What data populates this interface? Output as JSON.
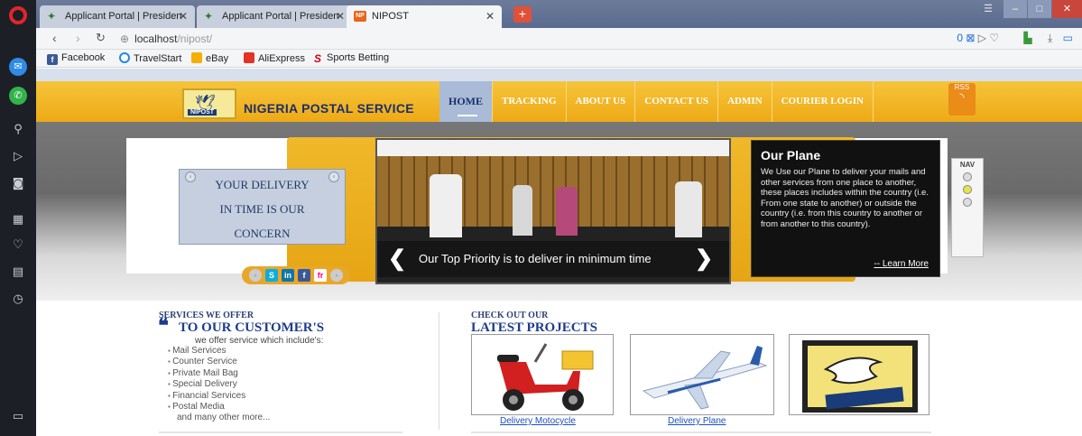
{
  "browser": {
    "tabs": [
      {
        "title": "Applicant Portal | Presiden",
        "active": false
      },
      {
        "title": "Applicant Portal | Presiden",
        "active": false
      },
      {
        "title": "NIPOST",
        "active": true
      }
    ],
    "favicon_np": "NP",
    "new_tab": "+",
    "url_host": "localhost",
    "url_path": "/nipost/",
    "window_controls": [
      "–",
      "□",
      "✕"
    ],
    "bookmarks": [
      {
        "label": "Facebook",
        "icon": "facebook-icon",
        "color": "#3b5998",
        "glyph": "f"
      },
      {
        "label": "TravelStart",
        "icon": "travelstart-icon",
        "color": "#1e88e5",
        "glyph": "O"
      },
      {
        "label": "eBay",
        "icon": "ebay-icon",
        "color": "#f5af02",
        "glyph": "e"
      },
      {
        "label": "AliExpress",
        "icon": "aliexpress-icon",
        "color": "#e43225",
        "glyph": "A"
      },
      {
        "label": "Sports Betting",
        "icon": "sportsbetting-icon",
        "color": "#d0021b",
        "glyph": "S"
      }
    ]
  },
  "site": {
    "name": "NIGERIA POSTAL SERVICE",
    "logo_tag": "NIPOST",
    "menu": [
      "HOME",
      "TRACKING",
      "ABOUT US",
      "CONTACT US",
      "ADMIN",
      "COURIER LOGIN"
    ],
    "rss_label": "RSS"
  },
  "banner": {
    "note_lines": [
      "YOUR DELIVERY",
      "IN TIME IS OUR",
      "CONCERN"
    ],
    "caption": "Our Top Priority is to deliver in minimum time",
    "social": [
      {
        "icon": "skype-icon",
        "glyph": "S",
        "color": "#0aaee0"
      },
      {
        "icon": "linkedin-icon",
        "glyph": "in",
        "color": "#0e76a8"
      },
      {
        "icon": "facebook-icon",
        "glyph": "f",
        "color": "#3b5998"
      },
      {
        "icon": "flickr-icon",
        "glyph": "fr",
        "color": "#ff0084"
      }
    ],
    "panel": {
      "title": "Our Plane",
      "body": "We Use our Plane to deliver your mails and other services from one place to another, these places includes within the country (i.e. From one state to another) or outside the country (i.e. from this country to another or from another to this country).",
      "link": "-- Learn More"
    },
    "nav_widget": "NAV"
  },
  "services": {
    "subtitle": "SERVICES WE OFFER",
    "title": "TO OUR CUSTOMER'S",
    "intro": "we offer service which include's:",
    "items": [
      "Mail Services",
      "Counter Service",
      "Private Mail Bag",
      "Special Delivery",
      "Financial Services",
      "Postal Media"
    ],
    "tail": "and many other more..."
  },
  "projects": {
    "subtitle": "CHECK OUT OUR",
    "title": "LATEST PROJECTS",
    "items": [
      {
        "caption": "Delivery Motocycle"
      },
      {
        "caption": "Delivery Plane"
      },
      {
        "caption": ""
      }
    ]
  },
  "colors": {
    "header": "#f0b42a",
    "brand_blue": "#1d3d8c",
    "link": "#1d4fbf"
  }
}
